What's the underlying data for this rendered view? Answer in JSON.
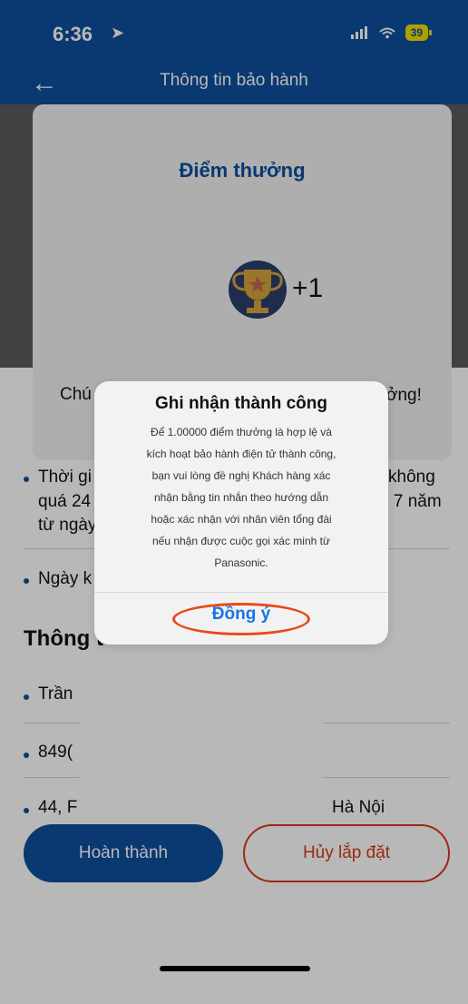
{
  "status": {
    "time": "6:36",
    "location_icon": "location-arrow-icon",
    "battery": "39"
  },
  "nav": {
    "title": "Thông tin bảo hành"
  },
  "card": {
    "title": "Điểm thưởng",
    "points": "+1",
    "congrats_left": "Chú",
    "congrats_right": "ởng!"
  },
  "list": {
    "rows": [
      {
        "left": "Thời gi",
        "right": "không"
      },
      {
        "left": "quá 24",
        "right": "n 7 năm"
      },
      {
        "left": "từ ngày",
        "right": ""
      },
      {
        "left": "Ngày k",
        "right": ""
      }
    ],
    "section_title": "Thông t",
    "customer_rows": [
      {
        "left": "Trần",
        "right": ""
      },
      {
        "left": "849(",
        "right": ""
      },
      {
        "left": "44, F",
        "right": "Hà Nội"
      }
    ]
  },
  "buttons": {
    "complete": "Hoàn thành",
    "cancel": "Hủy lắp đặt"
  },
  "alert": {
    "title": "Ghi nhận thành công",
    "message_lines": [
      "Để 1.00000 điểm thưởng là hợp lệ và",
      "kích hoạt bảo hành điện tử thành công,",
      "bạn vui lòng đề nghị Khách hàng xác",
      "nhận bằng tin nhắn theo hướng dẫn",
      "hoặc xác nhận với nhân viên tổng đài",
      "nếu nhận được cuộc gọi xác minh từ",
      "Panasonic."
    ],
    "ok": "Đồng ý"
  },
  "colors": {
    "brand": "#0d4f9b",
    "accent_red": "#d63a1a",
    "battery_yellow": "#f1de00",
    "link_blue": "#1a73e8"
  }
}
